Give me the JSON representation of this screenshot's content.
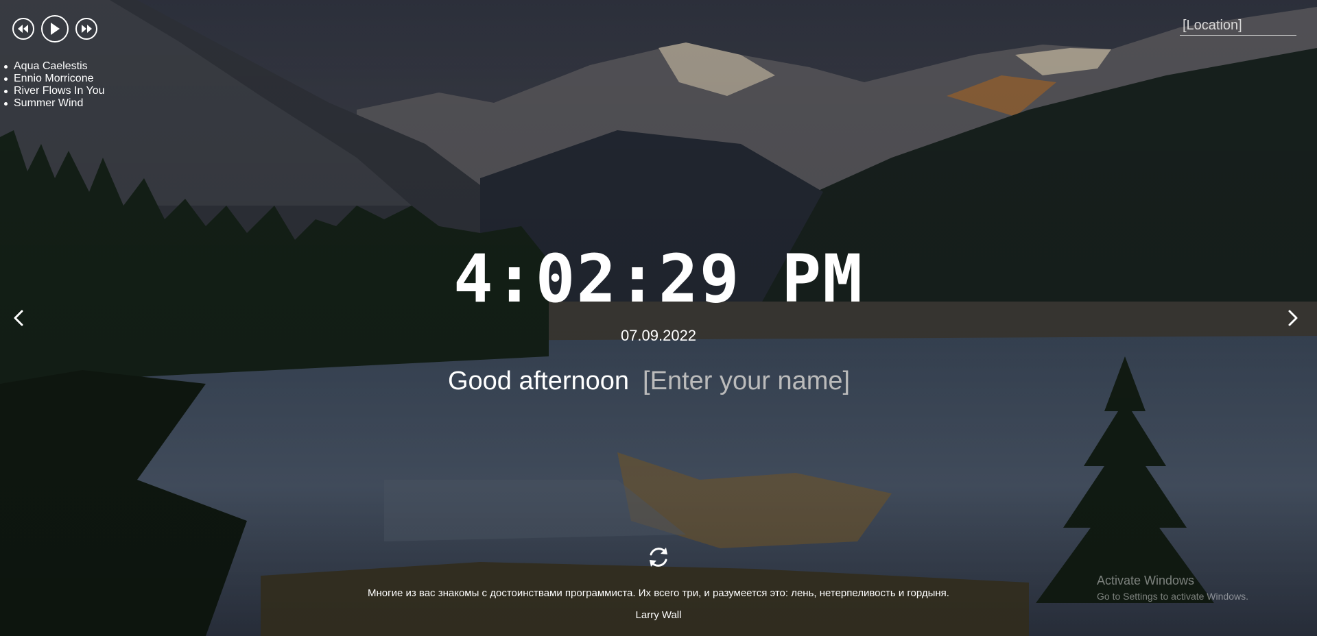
{
  "player": {
    "prev_icon": "rewind-icon",
    "play_icon": "play-icon",
    "next_icon": "fast-forward-icon"
  },
  "playlist": [
    "Aqua Caelestis",
    "Ennio Morricone",
    "River Flows In You",
    "Summer Wind"
  ],
  "weather": {
    "location_placeholder": "[Location]"
  },
  "slider": {
    "prev_icon": "chevron-left-icon",
    "next_icon": "chevron-right-icon"
  },
  "clock": {
    "time": "4:02:29 PM",
    "date": "07.09.2022"
  },
  "greeting": {
    "text": "Good afternoon",
    "name_placeholder": "[Enter your name]"
  },
  "quote": {
    "refresh_icon": "refresh-icon",
    "text": "Многие из вас знакомы с достоинствами программиста. Их всего три, и разумеется это: лень, нетерпеливость и гордыня.",
    "author": "Larry Wall"
  },
  "os_watermark": {
    "title": "Activate Windows",
    "subtitle": "Go to Settings to activate Windows."
  },
  "colors": {
    "text": "#ffffff",
    "placeholder": "#bbbbbb"
  }
}
